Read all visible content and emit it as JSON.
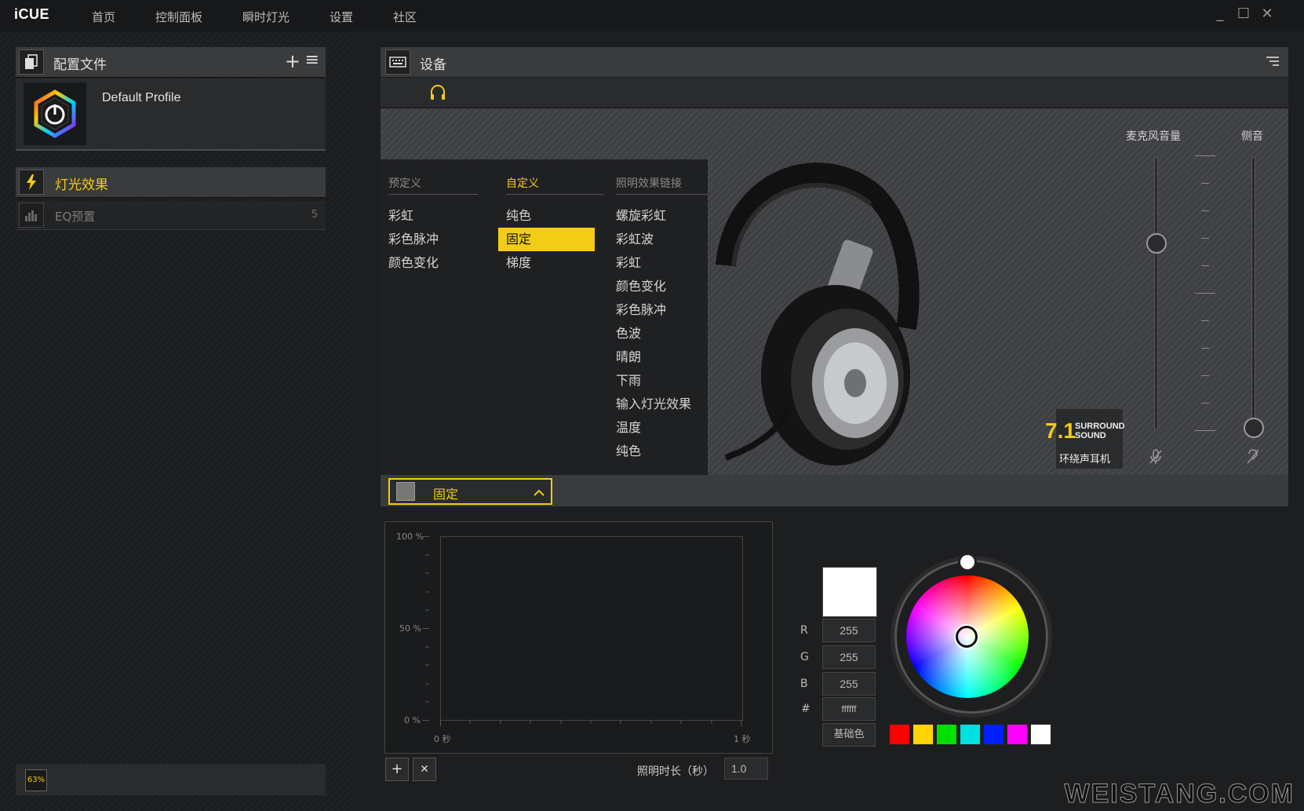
{
  "app": {
    "title": "iCUE"
  },
  "nav": [
    "首页",
    "控制面板",
    "瞬时灯光",
    "设置",
    "社区"
  ],
  "window_controls": {
    "minimize": "_",
    "maximize": "☐",
    "close": "✕"
  },
  "profiles_panel": {
    "title": "配置文件",
    "add_icon": "+",
    "menu_icon": "≡",
    "profile_name": "Default Profile"
  },
  "sections": {
    "lighting": "灯光效果",
    "eq": "EQ预置",
    "eq_count": "5"
  },
  "status": {
    "percent": "63%"
  },
  "device_panel": {
    "title": "设备"
  },
  "effects_menu": {
    "predefined": {
      "header": "预定义",
      "items": [
        "彩虹",
        "彩色脉冲",
        "颜色变化"
      ]
    },
    "custom": {
      "header": "自定义",
      "items": [
        "纯色",
        "固定",
        "梯度"
      ],
      "active": "固定"
    },
    "links": {
      "header": "照明效果链接",
      "items": [
        "螺旋彩虹",
        "彩虹波",
        "彩虹",
        "颜色变化",
        "彩色脉冲",
        "色波",
        "晴朗",
        "下雨",
        "输入灯光效果",
        "温度",
        "纯色"
      ]
    }
  },
  "sliders": {
    "mic_volume": {
      "label": "麦克风音量",
      "level": 0.68
    },
    "sidetone": {
      "label": "侧音",
      "level": 0.0
    }
  },
  "surround": {
    "number": "7.1",
    "line1": "SURROUND",
    "line2": "SOUND",
    "label": "环绕声耳机"
  },
  "effect_selector": {
    "value": "固定"
  },
  "graph": {
    "y_labels": [
      "100 %",
      "50 %",
      "0 %"
    ],
    "x_labels": [
      "0 秒",
      "1 秒"
    ]
  },
  "graph_controls": {
    "add": "+",
    "remove": "✕",
    "duration_label": "照明时长（秒）",
    "duration_value": "1.0"
  },
  "color": {
    "preview": "#ffffff",
    "r_label": "R",
    "r": "255",
    "g_label": "G",
    "g": "255",
    "b_label": "B",
    "b": "255",
    "hex_label": "#",
    "hex": "ffffff",
    "base_button": "基础色",
    "swatches": [
      "#ff0000",
      "#ffd400",
      "#00e000",
      "#00e0e0",
      "#0020ff",
      "#ff00ff",
      "#ffffff"
    ]
  },
  "accent": "#f2cc17",
  "watermark": "WEISTANG.COM"
}
